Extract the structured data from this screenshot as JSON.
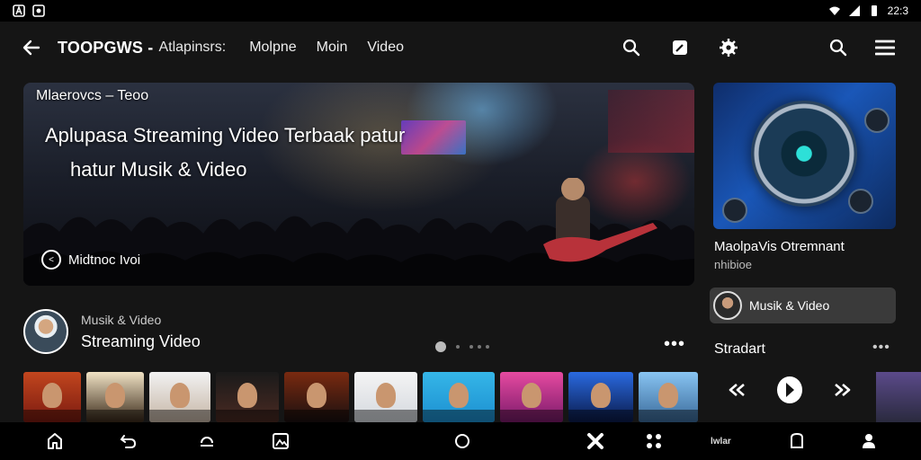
{
  "status_bar": {
    "time": "22:3"
  },
  "app_bar": {
    "title": "TOOPGWS -",
    "subtitle": "Atlapinsrs:",
    "nav": [
      "Molpne",
      "Moin",
      "Video"
    ]
  },
  "hero": {
    "kicker": "Mlaerovcs – Teoo",
    "headline_line1": "Aplupasa Streaming Video Terbaak  patur",
    "headline_line2": "hatur Musik & Video",
    "badge_label": "Midtnoc Ivoi"
  },
  "side_card": {
    "title": "MaolpaVis Otremnant",
    "subtitle": "nhibioe"
  },
  "chip": {
    "label": "Musik & Video"
  },
  "side_section": {
    "title": "Stradart",
    "more": "•••"
  },
  "profile": {
    "small": "Musik & Video",
    "big": "Streaming Video"
  },
  "more_label": "•••",
  "thumbnails": [
    {
      "color_top": "#c2461e",
      "color_bottom": "#7a1a10"
    },
    {
      "color_top": "#f0e2c4",
      "color_bottom": "#3a2a1a"
    },
    {
      "color_top": "#f2f2f2",
      "color_bottom": "#c5b5a5"
    },
    {
      "color_top": "#1a1a1a",
      "color_bottom": "#4a2a22"
    },
    {
      "color_top": "#7a2a10",
      "color_bottom": "#1a1010"
    },
    {
      "color_top": "#f4f4f4",
      "color_bottom": "#d4d8de"
    },
    {
      "color_top": "#35b6e8",
      "color_bottom": "#1c8fd0"
    },
    {
      "color_top": "#e64aa0",
      "color_bottom": "#7a1a6a"
    },
    {
      "color_top": "#2a6ae0",
      "color_bottom": "#0a1a4a"
    },
    {
      "color_top": "#88c4f2",
      "color_bottom": "#3a6a9a"
    }
  ],
  "bottom_nav": {
    "mini_label": "lwlar"
  },
  "colors": {
    "background": "#151515",
    "chip": "#3a3a3a",
    "accent_blue": "#1a57b8"
  }
}
